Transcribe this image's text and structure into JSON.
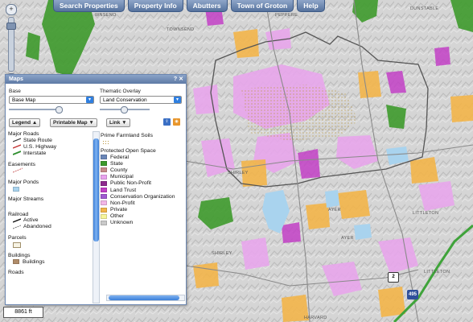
{
  "toolbar": {
    "buttons": [
      "Search Properties",
      "Property Info",
      "Abutters",
      "Town of Groton",
      "Help"
    ]
  },
  "map": {
    "labels": {
      "winsboro": "WNSENO",
      "townsend": "TOWNSEND",
      "pepperell": "PEPPERE",
      "dunstable": "DUNSTABLE",
      "shirley1": "SHIRLEY",
      "shirley2": "SHIRLEY",
      "ayer1": "AYER",
      "ayer2": "AYER",
      "littleton1": "LITTLETON",
      "littleton2": "LITTLETON",
      "harvard": "HARVARD"
    },
    "route_2": "2",
    "interstate_495": "495",
    "zoom_in": "+",
    "zoom_out": "−",
    "scale": "8861 ft",
    "colors": {
      "hillshade": "#d4d4d4",
      "municipal": "#e8a6ec",
      "protected_pink": "#d58be0",
      "private": "#f3b54a",
      "state": "#3e9a2c",
      "ponds": "#a9d3ee",
      "boundary": "#555555",
      "interstate": "#3fa33a"
    }
  },
  "panel": {
    "title": "Maps",
    "title_icons": "? ✕",
    "base_label": "Base",
    "base_value": "Base Map",
    "overlay_label": "Thematic Overlay",
    "overlay_value": "Land Conservation",
    "legend_button": "Legend ▲",
    "printable_button": "Printable Map ▼",
    "link_button": "Link ▼",
    "legend_left": {
      "major_roads": "Major Roads",
      "state_route": "State Route",
      "us_highway": "U.S. Highway",
      "interstate": "Interstate",
      "easements": "Easements",
      "major_ponds": "Major Ponds",
      "major_streams": "Major Streams",
      "railroad": "Railroad",
      "active": "Active",
      "abandoned": "Abandoned",
      "parcels": "Parcels",
      "buildings_hd": "Buildings",
      "buildings": "Buildings",
      "roads": "Roads"
    },
    "legend_right": {
      "prime_farmland": "Prime Farmland Soils",
      "protected_open_space": "Protected Open Space",
      "items": [
        {
          "label": "Federal",
          "color": "#6a86b8"
        },
        {
          "label": "State",
          "color": "#3c9a2c"
        },
        {
          "label": "County",
          "color": "#c78b8b"
        },
        {
          "label": "Municipal",
          "color": "#e9a3ee"
        },
        {
          "label": "Public Non-Profit",
          "color": "#8e2a8e"
        },
        {
          "label": "Land Trust",
          "color": "#c23fc6"
        },
        {
          "label": "Conservation Organization",
          "color": "#a15ad1"
        },
        {
          "label": "Non-Profit",
          "color": "#f2b6e6"
        },
        {
          "label": "Private",
          "color": "#f3b54a"
        },
        {
          "label": "Other",
          "color": "#f7f59b"
        },
        {
          "label": "Unknown",
          "color": "#c9c9c9"
        }
      ]
    }
  }
}
